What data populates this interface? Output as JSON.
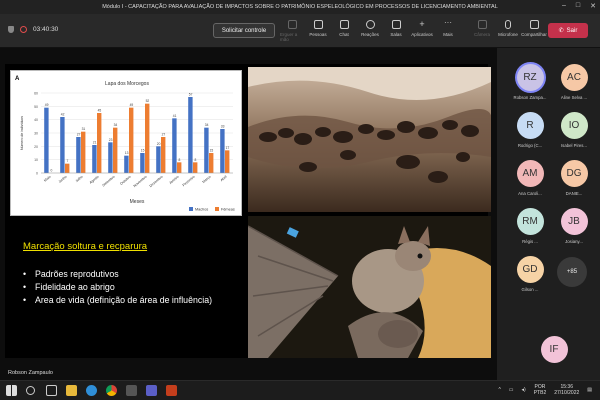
{
  "window": {
    "title": "Módulo I - CAPACITAÇÃO PARA AVALIAÇÃO DE IMPACTOS SOBRE O PATRIMÔNIO ESPELEOLÓGICO EM PROCESSOS DE LICENCIAMENTO AMBIENTAL"
  },
  "meeting": {
    "timer": "03:40:30",
    "request_control": "Solicitar controle",
    "tools": [
      {
        "label": "Pessoas",
        "icon": "people-icon"
      },
      {
        "label": "Chat",
        "icon": "chat-icon"
      },
      {
        "label": "Reações",
        "icon": "reactions-icon"
      },
      {
        "label": "Salas",
        "icon": "rooms-icon"
      },
      {
        "label": "Aplicativos",
        "icon": "apps-icon"
      },
      {
        "label": "Mais",
        "icon": "more-icon"
      }
    ],
    "raise_hand": "Erguer a mão",
    "camera": "Câmera",
    "mic": "Microfone",
    "share": "Compartilhar",
    "leave": "Sair",
    "presenter": "Robson Zampaulo"
  },
  "slide": {
    "heading": "Marcação soltura e recparura",
    "bullets": [
      "Padrões reprodutivos",
      "Fidelidade ao abrigo",
      "Area de vida (definição de área de influência)"
    ]
  },
  "chart_data": {
    "type": "bar",
    "panel_label": "A",
    "title": "Lapa dos Morcegos",
    "xlabel": "Meses",
    "ylabel": "Número de indivíduos",
    "ylim": [
      0,
      60
    ],
    "categories": [
      "Maio",
      "Junho",
      "Julho",
      "Agosto",
      "Setembro",
      "Outubro",
      "Novembro",
      "Dezembro",
      "Janeiro",
      "Fevereiro",
      "Março",
      "Abril"
    ],
    "series": [
      {
        "name": "Machos",
        "color": "#4472c4",
        "values": [
          49,
          42,
          27,
          21,
          23,
          13,
          15,
          20,
          41,
          57,
          34,
          33
        ]
      },
      {
        "name": "Fêmeas",
        "color": "#ed7d31",
        "values": [
          0,
          7,
          31,
          45,
          34,
          49,
          52,
          27,
          8,
          8,
          15,
          17
        ]
      }
    ]
  },
  "participants": [
    {
      "initials": "RZ",
      "name": "Robson Zampa...",
      "color": "#c9c3e6"
    },
    {
      "initials": "AC",
      "name": "Aline Selva ...",
      "color": "#f6c8a6"
    },
    {
      "initials": "R",
      "name": "Rodrigo (C...",
      "color": "#c7dcf4"
    },
    {
      "initials": "IO",
      "name": "Isabel Pires...",
      "color": "#cfe7c8"
    },
    {
      "initials": "AM",
      "name": "Ana Caroli...",
      "color": "#f2b8b8"
    },
    {
      "initials": "DG",
      "name": "DANIE...",
      "color": "#f6c8a6"
    },
    {
      "initials": "RM",
      "name": "Régis ...",
      "color": "#c3e4dc"
    },
    {
      "initials": "JB",
      "name": "Josiany...",
      "color": "#f2c3d8"
    },
    {
      "initials": "GD",
      "name": "Gilson ...",
      "color": "#f6d3a6"
    },
    {
      "initials": "IF",
      "name": "",
      "color": "#f2c3d8"
    }
  ],
  "more_participants": "+85",
  "taskbar": {
    "lang": "POR",
    "layout": "PTB2",
    "time": "15:36",
    "date": "27/10/2022"
  }
}
